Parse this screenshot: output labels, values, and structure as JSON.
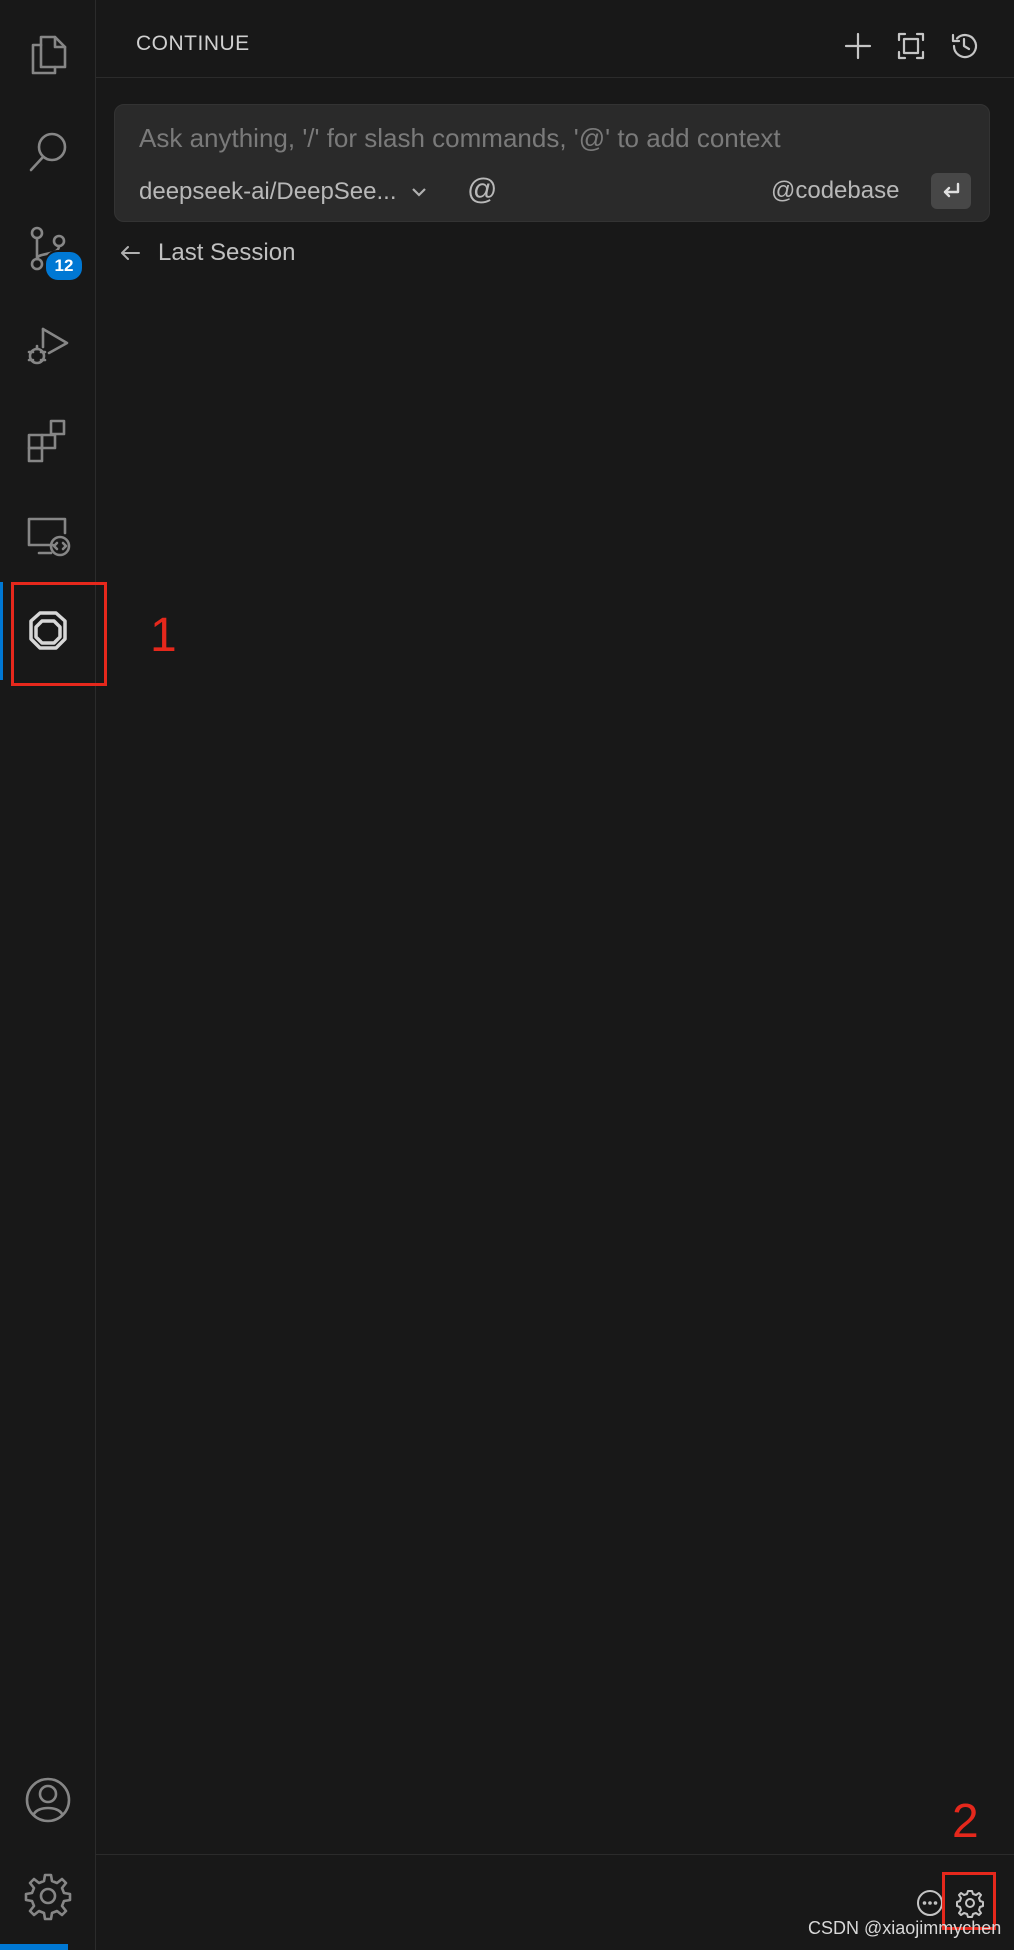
{
  "activity_bar": {
    "items": [
      {
        "name": "explorer",
        "icon": "files-icon"
      },
      {
        "name": "search",
        "icon": "search-icon"
      },
      {
        "name": "source-control",
        "icon": "source-control-icon",
        "badge": "12"
      },
      {
        "name": "run-debug",
        "icon": "run-debug-icon"
      },
      {
        "name": "extensions",
        "icon": "extensions-icon"
      },
      {
        "name": "remote-explorer",
        "icon": "remote-explorer-icon"
      },
      {
        "name": "continue",
        "icon": "continue-logo-icon",
        "active": true
      }
    ],
    "bottom_items": [
      {
        "name": "accounts",
        "icon": "account-icon"
      },
      {
        "name": "manage",
        "icon": "gear-icon"
      }
    ]
  },
  "panel": {
    "title": "CONTINUE",
    "header_actions": [
      "plus-icon",
      "fullscreen-icon",
      "history-icon"
    ]
  },
  "chat_input": {
    "placeholder": "Ask anything, '/' for slash commands, '@' to add context",
    "value": "",
    "model_selected": "deepseek-ai/DeepSee...",
    "at_symbol": "@",
    "codebase_label": "@codebase"
  },
  "last_session": {
    "label": "Last Session"
  },
  "footer": {
    "actions": [
      "more-icon",
      "gear-icon"
    ]
  },
  "annotations": {
    "label_1": "1",
    "label_2": "2",
    "color": "#e5281c"
  },
  "watermark": "CSDN @xiaojimmychen",
  "colors": {
    "accent": "#0078d4",
    "background": "#181818",
    "input_bg": "#2a2a2a"
  }
}
